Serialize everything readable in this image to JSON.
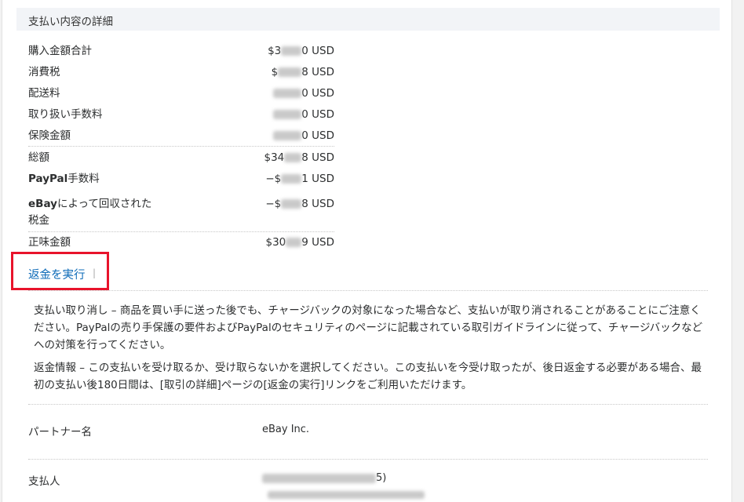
{
  "section": {
    "title": "支払い内容の詳細"
  },
  "rows": [
    {
      "label": "購入金額合計",
      "prefix": "$3",
      "suffix": "0 USD"
    },
    {
      "label": "消費税",
      "prefix": "$",
      "suffix": "8 USD"
    },
    {
      "label": "配送料",
      "prefix": "",
      "suffix": "0 USD"
    },
    {
      "label": "取り扱い手数料",
      "prefix": "",
      "suffix": "0 USD"
    },
    {
      "label": "保険金額",
      "prefix": "",
      "suffix": "0 USD"
    },
    {
      "label": "総額",
      "prefix": "$34",
      "suffix": "8 USD"
    },
    {
      "label_bold": "PayPal",
      "label_rest": "手数料",
      "prefix": "−$",
      "suffix": "1 USD"
    },
    {
      "label_bold": "eBay",
      "label_rest": "によって回収された",
      "label_line2": "税金",
      "prefix": "−$",
      "suffix": "8 USD"
    },
    {
      "label": "正味金額",
      "prefix": "$30",
      "suffix": "9 USD"
    }
  ],
  "refund": {
    "link_label": "返金を実行",
    "pipe": "|"
  },
  "notices": {
    "cancel": "支払い取り消し – 商品を買い手に送った後でも、チャージバックの対象になった場合など、支払いが取り消されることがあることにご注意ください。PayPalの売り手保護の要件およびPayPalのセキュリティのページに記載されている取引ガイドラインに従って、チャージバックなどへの対策を行ってください。",
    "refund_info": "返金情報 – この支払いを受け取るか、受け取らないかを選択してください。この支払いを今受け取ったが、後日返金する必要がある場合、最初の支払い後180日間は、[取引の詳細]ページの[返金の実行]リンクをご利用いただけます。"
  },
  "partner": {
    "label": "パートナー名",
    "value": "eBay Inc."
  },
  "payer": {
    "label": "支払人",
    "value_suffix": "5)"
  },
  "colors": {
    "link": "#0e6bb8",
    "highlight": "#e8132b",
    "header_bg": "#f2f4f7"
  }
}
